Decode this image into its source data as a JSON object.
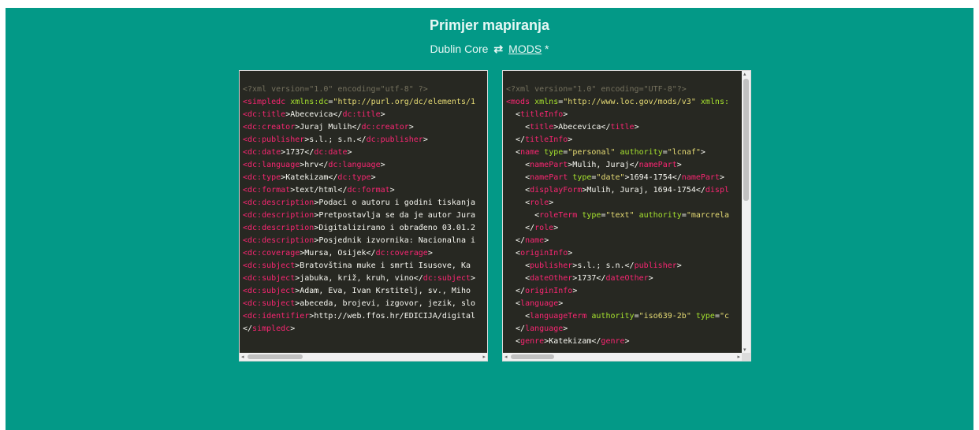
{
  "header": {
    "title": "Primjer mapiranja",
    "from_format": "Dublin Core",
    "swap_icon": "⇄",
    "to_format": "MODS",
    "suffix": "*"
  },
  "left_code": [
    [
      [
        "c",
        "<?xml version=\"1.0\" encoding=\"utf-8\" ?>"
      ]
    ],
    [
      [
        "t",
        "<simpledc "
      ],
      [
        "a",
        "xmlns:dc"
      ],
      [
        "p",
        "="
      ],
      [
        "s",
        "\"http://purl.org/dc/elements/1"
      ]
    ],
    [
      [
        "t",
        "<dc:title"
      ],
      [
        "p",
        ">Abecevica</"
      ],
      [
        "t",
        "dc:title"
      ],
      [
        "p",
        ">"
      ]
    ],
    [
      [
        "t",
        "<dc:creator"
      ],
      [
        "p",
        ">Juraj Mulih</"
      ],
      [
        "t",
        "dc:creator"
      ],
      [
        "p",
        ">"
      ]
    ],
    [
      [
        "t",
        "<dc:publisher"
      ],
      [
        "p",
        ">s.l.; s.n.</"
      ],
      [
        "t",
        "dc:publisher"
      ],
      [
        "p",
        ">"
      ]
    ],
    [
      [
        "t",
        "<dc:date"
      ],
      [
        "p",
        ">1737</"
      ],
      [
        "t",
        "dc:date"
      ],
      [
        "p",
        ">"
      ]
    ],
    [
      [
        "t",
        "<dc:language"
      ],
      [
        "p",
        ">hrv</"
      ],
      [
        "t",
        "dc:language"
      ],
      [
        "p",
        ">"
      ]
    ],
    [
      [
        "t",
        "<dc:type"
      ],
      [
        "p",
        ">Katekizam</"
      ],
      [
        "t",
        "dc:type"
      ],
      [
        "p",
        ">"
      ]
    ],
    [
      [
        "t",
        "<dc:format"
      ],
      [
        "p",
        ">text/html</"
      ],
      [
        "t",
        "dc:format"
      ],
      [
        "p",
        ">"
      ]
    ],
    [
      [
        "t",
        "<dc:description"
      ],
      [
        "p",
        ">Podaci o autoru i godini tiskanja"
      ]
    ],
    [
      [
        "t",
        "<dc:description"
      ],
      [
        "p",
        ">Pretpostavlja se da je autor Jura"
      ]
    ],
    [
      [
        "t",
        "<dc:description"
      ],
      [
        "p",
        ">Digitalizirano i obrađeno 03.01.2"
      ]
    ],
    [
      [
        "t",
        "<dc:description"
      ],
      [
        "p",
        ">Posjednik izvornika: Nacionalna i"
      ]
    ],
    [
      [
        "t",
        "<dc:coverage"
      ],
      [
        "p",
        ">Mursa, Osijek</"
      ],
      [
        "t",
        "dc:coverage"
      ],
      [
        "p",
        ">"
      ]
    ],
    [
      [
        "t",
        "<dc:subject"
      ],
      [
        "p",
        ">Bratovština muke i smrti Isusove, Ka"
      ]
    ],
    [
      [
        "t",
        "<dc:subject"
      ],
      [
        "p",
        ">jabuka, križ, kruh, vino</"
      ],
      [
        "t",
        "dc:subject"
      ],
      [
        "p",
        ">"
      ]
    ],
    [
      [
        "t",
        "<dc:subject"
      ],
      [
        "p",
        ">Adam, Eva, Ivan Krstitelj, sv., Miho"
      ]
    ],
    [
      [
        "t",
        "<dc:subject"
      ],
      [
        "p",
        ">abeceda, brojevi, izgovor, jezik, slo"
      ]
    ],
    [
      [
        "t",
        "<dc:identifier"
      ],
      [
        "p",
        ">http://web.ffos.hr/EDICIJA/digital"
      ]
    ],
    [
      [
        "p",
        "</"
      ],
      [
        "t",
        "simpledc"
      ],
      [
        "p",
        ">"
      ]
    ]
  ],
  "right_code": [
    [
      [
        "c",
        "<?xml version=\"1.0\" encoding=\"UTF-8\"?>"
      ]
    ],
    [
      [
        "t",
        "<mods "
      ],
      [
        "a",
        "xmlns"
      ],
      [
        "p",
        "="
      ],
      [
        "s",
        "\"http://www.loc.gov/mods/v3\""
      ],
      [
        "a",
        " xmlns:"
      ]
    ],
    [
      [
        "p",
        "  <"
      ],
      [
        "t",
        "titleInfo"
      ],
      [
        "p",
        ">"
      ]
    ],
    [
      [
        "p",
        "    <"
      ],
      [
        "t",
        "title"
      ],
      [
        "p",
        ">Abecevica</"
      ],
      [
        "t",
        "title"
      ],
      [
        "p",
        ">"
      ]
    ],
    [
      [
        "p",
        "  </"
      ],
      [
        "t",
        "titleInfo"
      ],
      [
        "p",
        ">"
      ]
    ],
    [
      [
        "p",
        "  <"
      ],
      [
        "t",
        "name "
      ],
      [
        "a",
        "type"
      ],
      [
        "p",
        "="
      ],
      [
        "s",
        "\"personal\""
      ],
      [
        "a",
        " authority"
      ],
      [
        "p",
        "="
      ],
      [
        "s",
        "\"lcnaf\""
      ],
      [
        "p",
        ">"
      ]
    ],
    [
      [
        "p",
        "    <"
      ],
      [
        "t",
        "namePart"
      ],
      [
        "p",
        ">Mulih, Juraj</"
      ],
      [
        "t",
        "namePart"
      ],
      [
        "p",
        ">"
      ]
    ],
    [
      [
        "p",
        "    <"
      ],
      [
        "t",
        "namePart "
      ],
      [
        "a",
        "type"
      ],
      [
        "p",
        "="
      ],
      [
        "s",
        "\"date\""
      ],
      [
        "p",
        ">1694-1754</"
      ],
      [
        "t",
        "namePart"
      ],
      [
        "p",
        ">"
      ]
    ],
    [
      [
        "p",
        "    <"
      ],
      [
        "t",
        "displayForm"
      ],
      [
        "p",
        ">Mulih, Juraj, 1694-1754</"
      ],
      [
        "t",
        "displ"
      ]
    ],
    [
      [
        "p",
        "    <"
      ],
      [
        "t",
        "role"
      ],
      [
        "p",
        ">"
      ]
    ],
    [
      [
        "p",
        "      <"
      ],
      [
        "t",
        "roleTerm "
      ],
      [
        "a",
        "type"
      ],
      [
        "p",
        "="
      ],
      [
        "s",
        "\"text\""
      ],
      [
        "a",
        " authority"
      ],
      [
        "p",
        "="
      ],
      [
        "s",
        "\"marcrela"
      ]
    ],
    [
      [
        "p",
        "    </"
      ],
      [
        "t",
        "role"
      ],
      [
        "p",
        ">"
      ]
    ],
    [
      [
        "p",
        "  </"
      ],
      [
        "t",
        "name"
      ],
      [
        "p",
        ">"
      ]
    ],
    [
      [
        "p",
        "  <"
      ],
      [
        "t",
        "originInfo"
      ],
      [
        "p",
        ">"
      ]
    ],
    [
      [
        "p",
        "    <"
      ],
      [
        "t",
        "publisher"
      ],
      [
        "p",
        ">s.l.; s.n.</"
      ],
      [
        "t",
        "publisher"
      ],
      [
        "p",
        ">"
      ]
    ],
    [
      [
        "p",
        "    <"
      ],
      [
        "t",
        "dateOther"
      ],
      [
        "p",
        ">1737</"
      ],
      [
        "t",
        "dateOther"
      ],
      [
        "p",
        ">"
      ]
    ],
    [
      [
        "p",
        "  </"
      ],
      [
        "t",
        "originInfo"
      ],
      [
        "p",
        ">"
      ]
    ],
    [
      [
        "p",
        "  <"
      ],
      [
        "t",
        "language"
      ],
      [
        "p",
        ">"
      ]
    ],
    [
      [
        "p",
        "    <"
      ],
      [
        "t",
        "languageTerm "
      ],
      [
        "a",
        "authority"
      ],
      [
        "p",
        "="
      ],
      [
        "s",
        "\"iso639-2b\""
      ],
      [
        "a",
        " type"
      ],
      [
        "p",
        "="
      ],
      [
        "s",
        "\"c"
      ]
    ],
    [
      [
        "p",
        "  </"
      ],
      [
        "t",
        "language"
      ],
      [
        "p",
        ">"
      ]
    ],
    [
      [
        "p",
        "  <"
      ],
      [
        "t",
        "genre"
      ],
      [
        "p",
        ">Katekizam</"
      ],
      [
        "t",
        "genre"
      ],
      [
        "p",
        ">"
      ]
    ]
  ],
  "colors": {
    "background": "#039987",
    "editor_bg": "#272822",
    "tag": "#f92672",
    "attribute": "#a6e22e",
    "string": "#e6db74",
    "comment": "#75715e"
  },
  "icons": {
    "scroll_left": "◂",
    "scroll_right": "▸",
    "scroll_up": "▴",
    "scroll_down": "▾"
  }
}
